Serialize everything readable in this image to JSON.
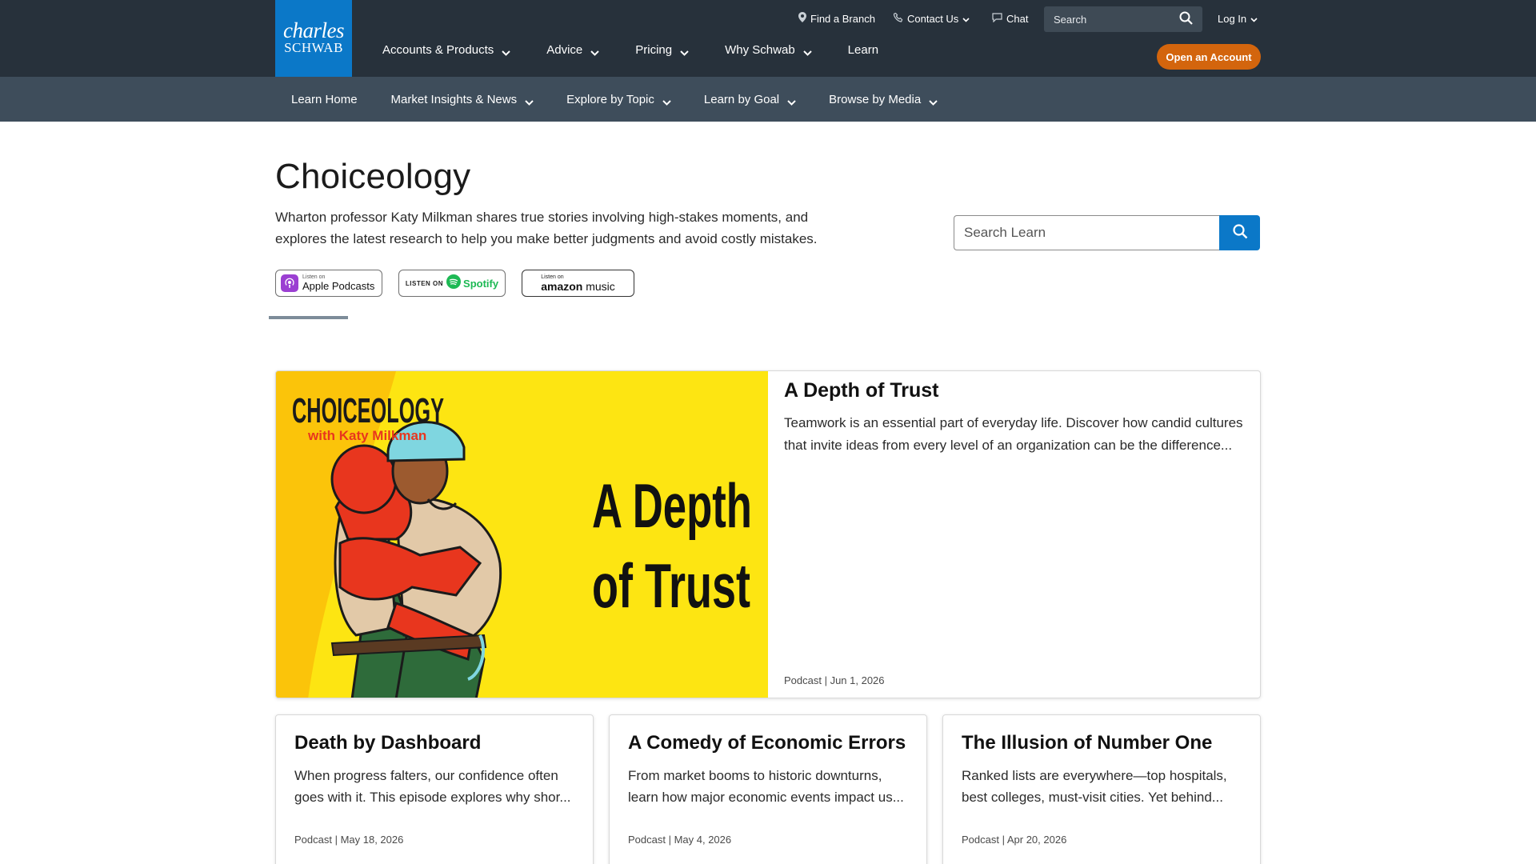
{
  "brand": {
    "logo_line1": "charles",
    "logo_line2": "SCHWAB",
    "color": "#0b78c8"
  },
  "utility_nav": {
    "find_branch": "Find a Branch",
    "contact_us": "Contact Us",
    "chat": "Chat",
    "search_placeholder": "Search",
    "login": "Log In"
  },
  "main_nav": {
    "items": [
      {
        "label": "Accounts & Products",
        "has_menu": true
      },
      {
        "label": "Advice",
        "has_menu": true
      },
      {
        "label": "Pricing",
        "has_menu": true
      },
      {
        "label": "Why Schwab",
        "has_menu": true
      },
      {
        "label": "Learn",
        "has_menu": false
      }
    ],
    "cta": "Open an Account",
    "cta_color": "#d3650d"
  },
  "sub_nav": {
    "items": [
      {
        "label": "Learn Home",
        "has_menu": false
      },
      {
        "label": "Market Insights & News",
        "has_menu": true
      },
      {
        "label": "Explore by Topic",
        "has_menu": true
      },
      {
        "label": "Learn by Goal",
        "has_menu": true
      },
      {
        "label": "Browse by Media",
        "has_menu": true
      }
    ]
  },
  "hero": {
    "title": "Choiceology",
    "description": "Wharton professor Katy Milkman shares true stories involving high-stakes moments, and explores the latest research to help you make better judgments and avoid costly mistakes.",
    "badges": {
      "apple_small": "Listen on",
      "apple_big": "Apple Podcasts",
      "spotify_listen": "LISTEN ON",
      "spotify_word": "Spotify",
      "amazon_small": "Listen on",
      "amazon_big_bold": "amazon",
      "amazon_big": " music"
    },
    "search_placeholder": "Search Learn"
  },
  "featured": {
    "art": {
      "show": "CHOICEOLOGY",
      "host": "with Katy Milkman",
      "title_line1": "A Depth",
      "title_line2": "of Trust"
    },
    "title": "A Depth of Trust",
    "description": "Teamwork is an essential part of everyday life. Discover how candid cultures that invite ideas from every level of an organization can be the difference...",
    "meta": "Podcast | Jun 1, 2026"
  },
  "episodes": [
    {
      "title": "Death by Dashboard",
      "description": "When progress falters, our confidence often goes with it. This episode explores why shor...",
      "meta": "Podcast | May 18, 2026"
    },
    {
      "title": "A Comedy of Economic Errors",
      "description": "From market booms to historic downturns, learn how major economic events impact us...",
      "meta": "Podcast | May 4, 2026"
    },
    {
      "title": "The Illusion of Number One",
      "description": "Ranked lists are everywhere—top hospitals, best colleges, must-visit cities. Yet behind...",
      "meta": "Podcast | Apr 20, 2026"
    }
  ]
}
